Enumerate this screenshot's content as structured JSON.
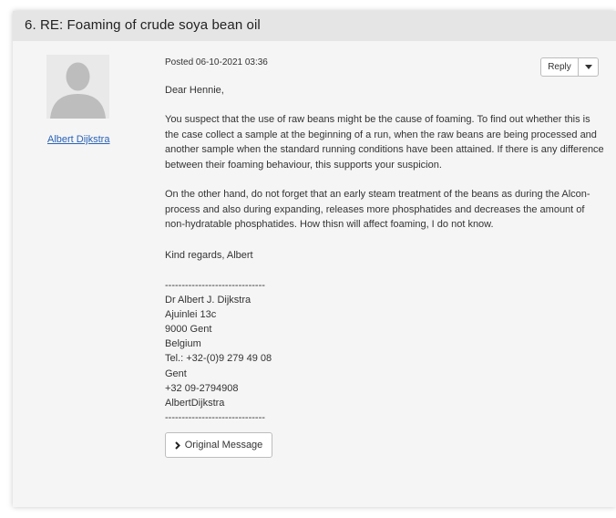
{
  "thread": {
    "title": "6.  RE: Foaming of crude soya bean oil"
  },
  "author": {
    "avatar_icon": "default-user-avatar-icon",
    "name": "Albert Dijkstra"
  },
  "post": {
    "posted": "Posted 06-10-2021 03:36",
    "reply_label": "Reply",
    "greeting": "Dear Hennie,",
    "paragraphs": [
      "You suspect that the use of raw beans might be the cause of foaming. To find out whether this is the case collect a sample at the beginning of a run, when the raw beans are being processed and another sample when the standard running conditions have been attained. If there is any difference between their foaming behaviour, this supports your suspicion.",
      "On the other hand, do not forget that an early steam treatment of the beans as during the Alcon-process and also during expanding, releases more phosphatides and decreases the amount of non-hydratable phosphatides. How thisn will affect foaming, I do not know.",
      "Kind regards, Albert"
    ],
    "signature": [
      "------------------------------",
      "Dr Albert J. Dijkstra",
      "Ajuinlei 13c",
      "9000 Gent",
      "Belgium",
      "Tel.: +32-(0)9 279 49 08",
      "Gent",
      "+32 09-2794908",
      "AlbertDijkstra",
      "------------------------------"
    ],
    "original_message_label": "Original Message"
  },
  "colors": {
    "link": "#2a63b7",
    "header_bg": "#e5e5e5",
    "card_bg": "#f5f5f5"
  }
}
